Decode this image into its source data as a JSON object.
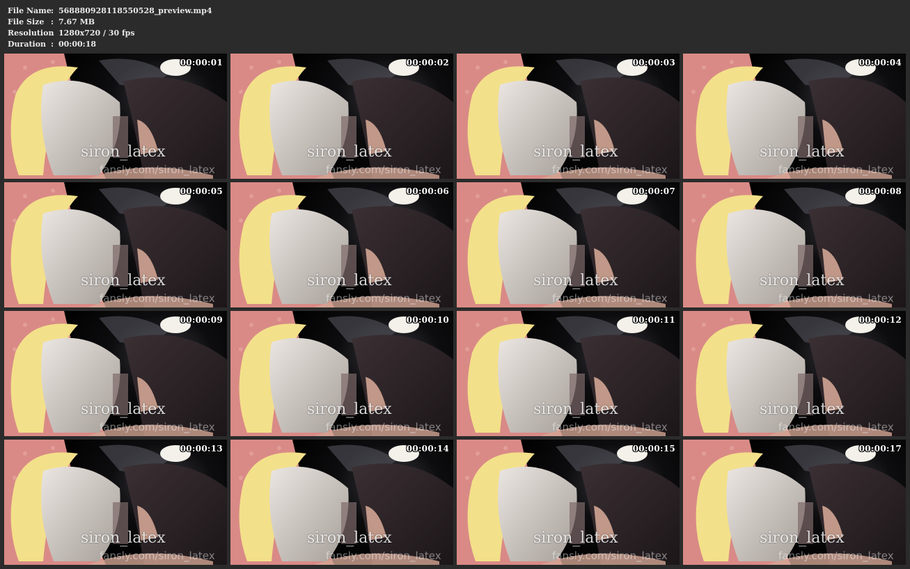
{
  "file_info": {
    "rows": [
      {
        "key": "File Name",
        "sep": ":",
        "value": "568880928118550528_preview.mp4"
      },
      {
        "key": "File Size",
        "sep": ":",
        "value": "7.67 MB"
      },
      {
        "key": "Resolution",
        "sep": ":",
        "value": "1280x720 / 30 fps"
      },
      {
        "key": "Duration",
        "sep": ":",
        "value": "00:00:18"
      }
    ]
  },
  "thumbnails": [
    {
      "timestamp": "00:00:01",
      "wm1": "siron_latex",
      "wm2": "fansly.com/siron_latex"
    },
    {
      "timestamp": "00:00:02",
      "wm1": "siron_latex",
      "wm2": "fansly.com/siron_latex"
    },
    {
      "timestamp": "00:00:03",
      "wm1": "siron_latex",
      "wm2": "fansly.com/siron_latex"
    },
    {
      "timestamp": "00:00:04",
      "wm1": "siron_latex",
      "wm2": "fansly.com/siron_latex"
    },
    {
      "timestamp": "00:00:05",
      "wm1": "siron_latex",
      "wm2": "fansly.com/siron_latex"
    },
    {
      "timestamp": "00:00:06",
      "wm1": "siron_latex",
      "wm2": "fansly.com/siron_latex"
    },
    {
      "timestamp": "00:00:07",
      "wm1": "siron_latex",
      "wm2": "fansly.com/siron_latex"
    },
    {
      "timestamp": "00:00:08",
      "wm1": "siron_latex",
      "wm2": "fansly.com/siron_latex"
    },
    {
      "timestamp": "00:00:09",
      "wm1": "siron_latex",
      "wm2": "fansly.com/siron_latex"
    },
    {
      "timestamp": "00:00:10",
      "wm1": "siron_latex",
      "wm2": "fansly.com/siron_latex"
    },
    {
      "timestamp": "00:00:11",
      "wm1": "siron_latex",
      "wm2": "fansly.com/siron_latex"
    },
    {
      "timestamp": "00:00:12",
      "wm1": "siron_latex",
      "wm2": "fansly.com/siron_latex"
    },
    {
      "timestamp": "00:00:13",
      "wm1": "siron_latex",
      "wm2": "fansly.com/siron_latex"
    },
    {
      "timestamp": "00:00:14",
      "wm1": "siron_latex",
      "wm2": "fansly.com/siron_latex"
    },
    {
      "timestamp": "00:00:15",
      "wm1": "siron_latex",
      "wm2": "fansly.com/siron_latex"
    },
    {
      "timestamp": "00:00:17",
      "wm1": "siron_latex",
      "wm2": "fansly.com/siron_latex"
    }
  ],
  "colors": {
    "background": "#2b2b2b",
    "header_text": "#e8e8e8",
    "pink_backdrop": "#d98a86",
    "latex_black": "#0d0d0f",
    "frill_yellow": "#f3e08a",
    "silver_hair": "#cfc8c2",
    "dark_hair": "#1c1618",
    "skin": "#d2a594"
  }
}
